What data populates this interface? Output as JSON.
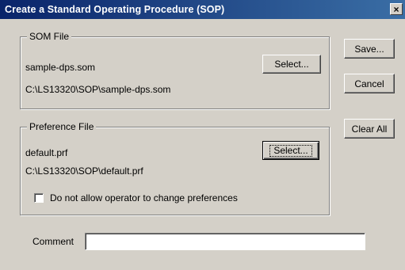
{
  "window": {
    "title": "Create a Standard Operating Procedure (SOP)",
    "close_glyph": "×"
  },
  "som_file": {
    "legend": "SOM File",
    "filename": "sample-dps.som",
    "path": "C:\\LS13320\\SOP\\sample-dps.som",
    "select_label": "Select..."
  },
  "preference_file": {
    "legend": "Preference File",
    "filename": "default.prf",
    "path": "C:\\LS13320\\SOP\\default.prf",
    "select_label": "Select...",
    "checkbox_label": "Do not allow operator to change preferences",
    "checkbox_checked": false
  },
  "buttons": {
    "save": "Save...",
    "cancel": "Cancel",
    "clear_all": "Clear All"
  },
  "comment": {
    "label": "Comment",
    "value": ""
  }
}
